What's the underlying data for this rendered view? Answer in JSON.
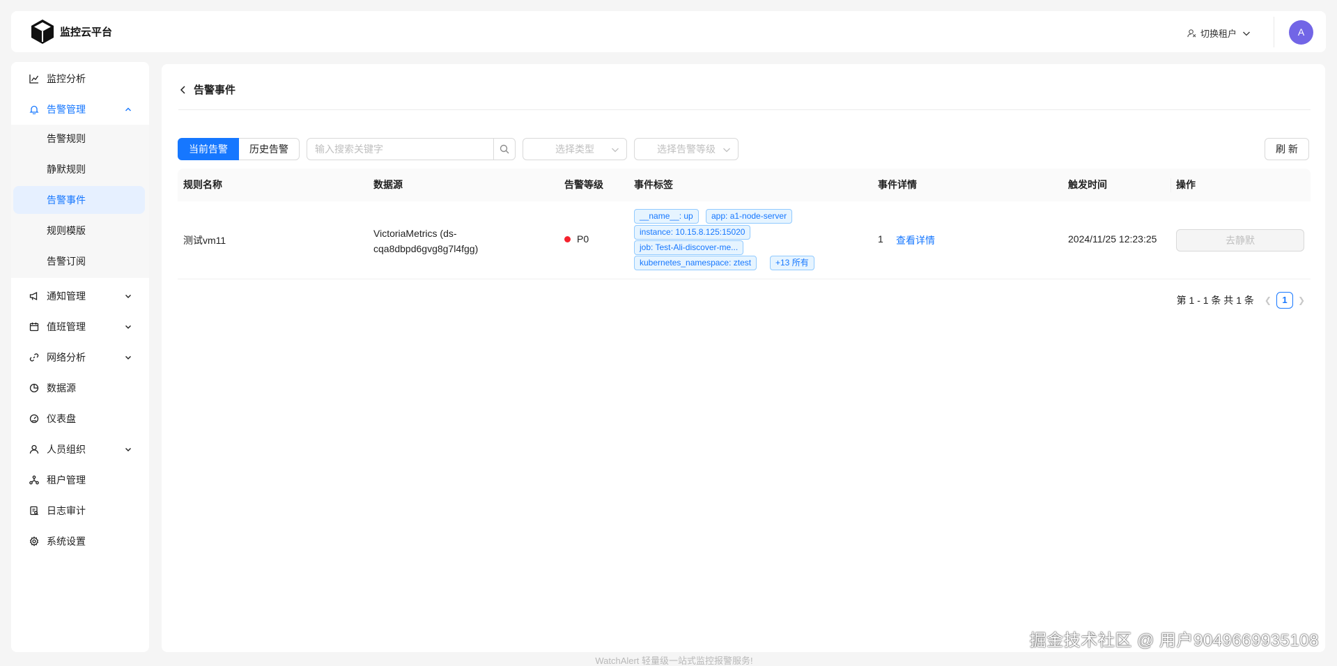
{
  "header": {
    "app_name": "监控云平台",
    "tenant_switch": "切换租户",
    "avatar_letter": "A"
  },
  "sidebar": {
    "items": [
      {
        "label": "监控分析",
        "icon": "bar-chart-icon"
      },
      {
        "label": "告警管理",
        "icon": "bell-icon",
        "expanded": true
      },
      {
        "label": "通知管理",
        "icon": "megaphone-icon"
      },
      {
        "label": "值班管理",
        "icon": "calendar-icon"
      },
      {
        "label": "网络分析",
        "icon": "link-icon"
      },
      {
        "label": "数据源",
        "icon": "pie-chart-icon"
      },
      {
        "label": "仪表盘",
        "icon": "dashboard-icon"
      },
      {
        "label": "人员组织",
        "icon": "user-icon"
      },
      {
        "label": "租户管理",
        "icon": "cluster-icon"
      },
      {
        "label": "日志审计",
        "icon": "audit-icon"
      },
      {
        "label": "系统设置",
        "icon": "gear-icon"
      }
    ],
    "alert_submenu": [
      "告警规则",
      "静默规则",
      "告警事件",
      "规则模版",
      "告警订阅"
    ],
    "active_submenu": "告警事件"
  },
  "page": {
    "title": "告警事件",
    "tabs": [
      "当前告警",
      "历史告警"
    ],
    "active_tab": "当前告警",
    "search_placeholder": "输入搜索关键字",
    "type_select_placeholder": "选择类型",
    "level_select_placeholder": "选择告警等级",
    "refresh_label": "刷 新"
  },
  "table": {
    "columns": [
      "规则名称",
      "数据源",
      "告警等级",
      "事件标签",
      "事件详情",
      "触发时间",
      "操作"
    ],
    "rows": [
      {
        "rule_name": "测试vm11",
        "datasource_line1": "VictoriaMetrics (ds-",
        "datasource_line2": "cqa8dbpd6gvg8g7l4fgg)",
        "level": "P0",
        "tags": [
          "__name__: up",
          "app: a1-node-server",
          "instance: 10.15.8.125:15020",
          "job: Test-Ali-discover-me...",
          "kubernetes_namespace: ztest",
          "+13 所有"
        ],
        "detail_count": "1",
        "detail_link": "查看详情",
        "trigger_time": "2024/11/25 12:23:25",
        "action": "去静默"
      }
    ]
  },
  "pagination": {
    "summary": "第 1 - 1 条 共 1 条",
    "current_page": "1"
  },
  "footer": "WatchAlert 轻量级一站式监控报警服务!",
  "watermark": "掘金技术社区 @ 用户9049669935108",
  "colors": {
    "primary": "#1677ff",
    "avatar": "#7265e6",
    "danger_dot": "#f5222d"
  }
}
